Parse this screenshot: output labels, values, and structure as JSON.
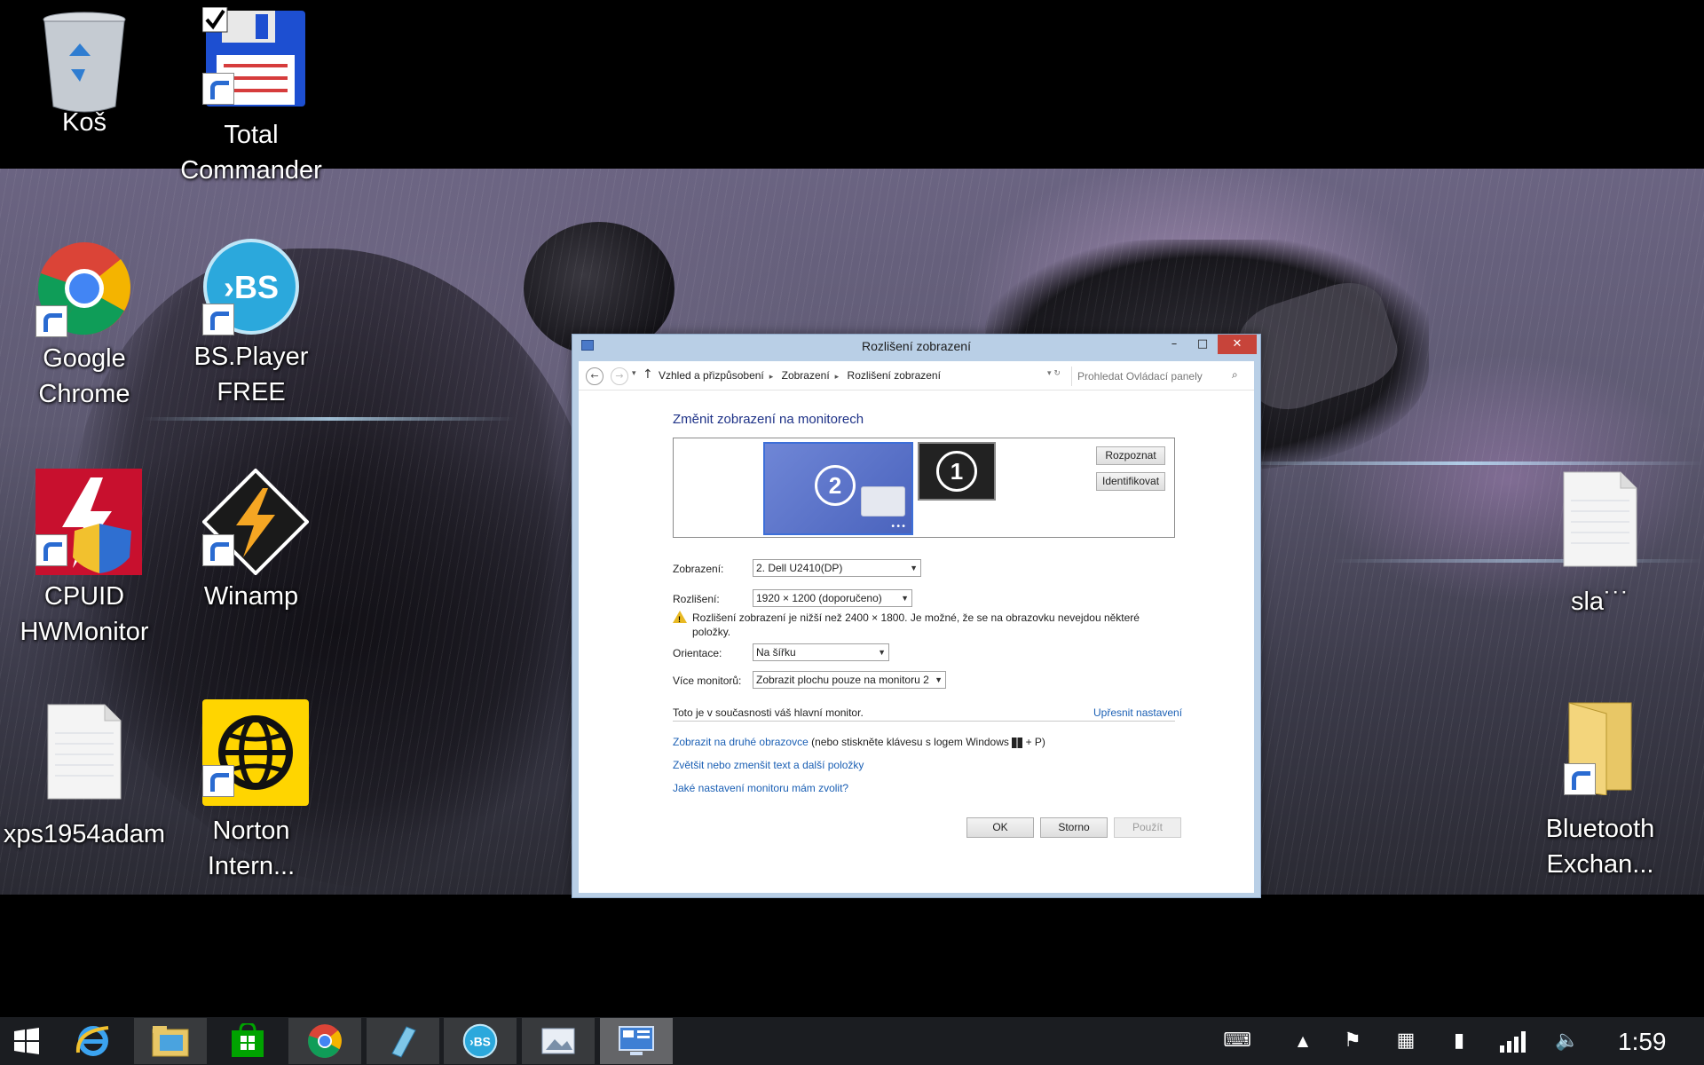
{
  "desktop": {
    "icons": {
      "recycle_bin": "Koš",
      "total_commander_1": "Total",
      "total_commander_2": "Commander",
      "chrome_1": "Google",
      "chrome_2": "Chrome",
      "bsplayer_1": "BS.Player",
      "bsplayer_2": "FREE",
      "cpuid_1": "CPUID",
      "cpuid_2": "HWMonitor",
      "winamp": "Winamp",
      "xps": "xps1954adam",
      "norton_1": "Norton",
      "norton_2": "Intern...",
      "sla": "sla˙˙˙",
      "bluetooth_1": "Bluetooth",
      "bluetooth_2": "Exchan..."
    }
  },
  "dialog": {
    "title": "Rozlišení zobrazení",
    "breadcrumb": [
      "Vzhled a přizpůsobení",
      "Zobrazení",
      "Rozlišení zobrazení"
    ],
    "search_placeholder": "Prohledat Ovládací panely",
    "heading": "Změnit zobrazení na monitorech",
    "monitor_2": "2",
    "monitor_1": "1",
    "detect": "Rozpoznat",
    "identify": "Identifikovat",
    "display_label": "Zobrazení:",
    "display_value": "2. Dell U2410(DP)",
    "resolution_label": "Rozlišení:",
    "resolution_value": "1920 × 1200 (doporučeno)",
    "warning": "Rozlišení zobrazení je nižší než 2400 × 1800. Je možné, že se na obrazovku nevejdou některé položky.",
    "orientation_label": "Orientace:",
    "orientation_value": "Na šířku",
    "multi_label": "Více monitorů:",
    "multi_value": "Zobrazit plochu pouze na monitoru 2",
    "main_monitor_text": "Toto je v současnosti váš hlavní monitor.",
    "advanced_link": "Upřesnit nastavení",
    "project_link": "Zobrazit na druhé obrazovce",
    "project_hint_1": "(nebo stiskněte klávesu s logem Windows",
    "project_hint_2": "+ P)",
    "textsize_link": "Zvětšit nebo zmenšit text a další položky",
    "which_link": "Jaké nastavení monitoru mám zvolit?",
    "ok": "OK",
    "cancel": "Storno",
    "apply": "Použít"
  },
  "taskbar": {
    "clock": "1:59",
    "apps": [
      "start",
      "internet-explorer",
      "file-explorer",
      "store",
      "chrome",
      "notepad",
      "bsplayer",
      "photo-viewer",
      "control-panel"
    ],
    "colors": {
      "taskbar": "#1b1d21",
      "close": "#c7443a",
      "link": "#1a5fb4",
      "heading": "#1e3287"
    }
  }
}
